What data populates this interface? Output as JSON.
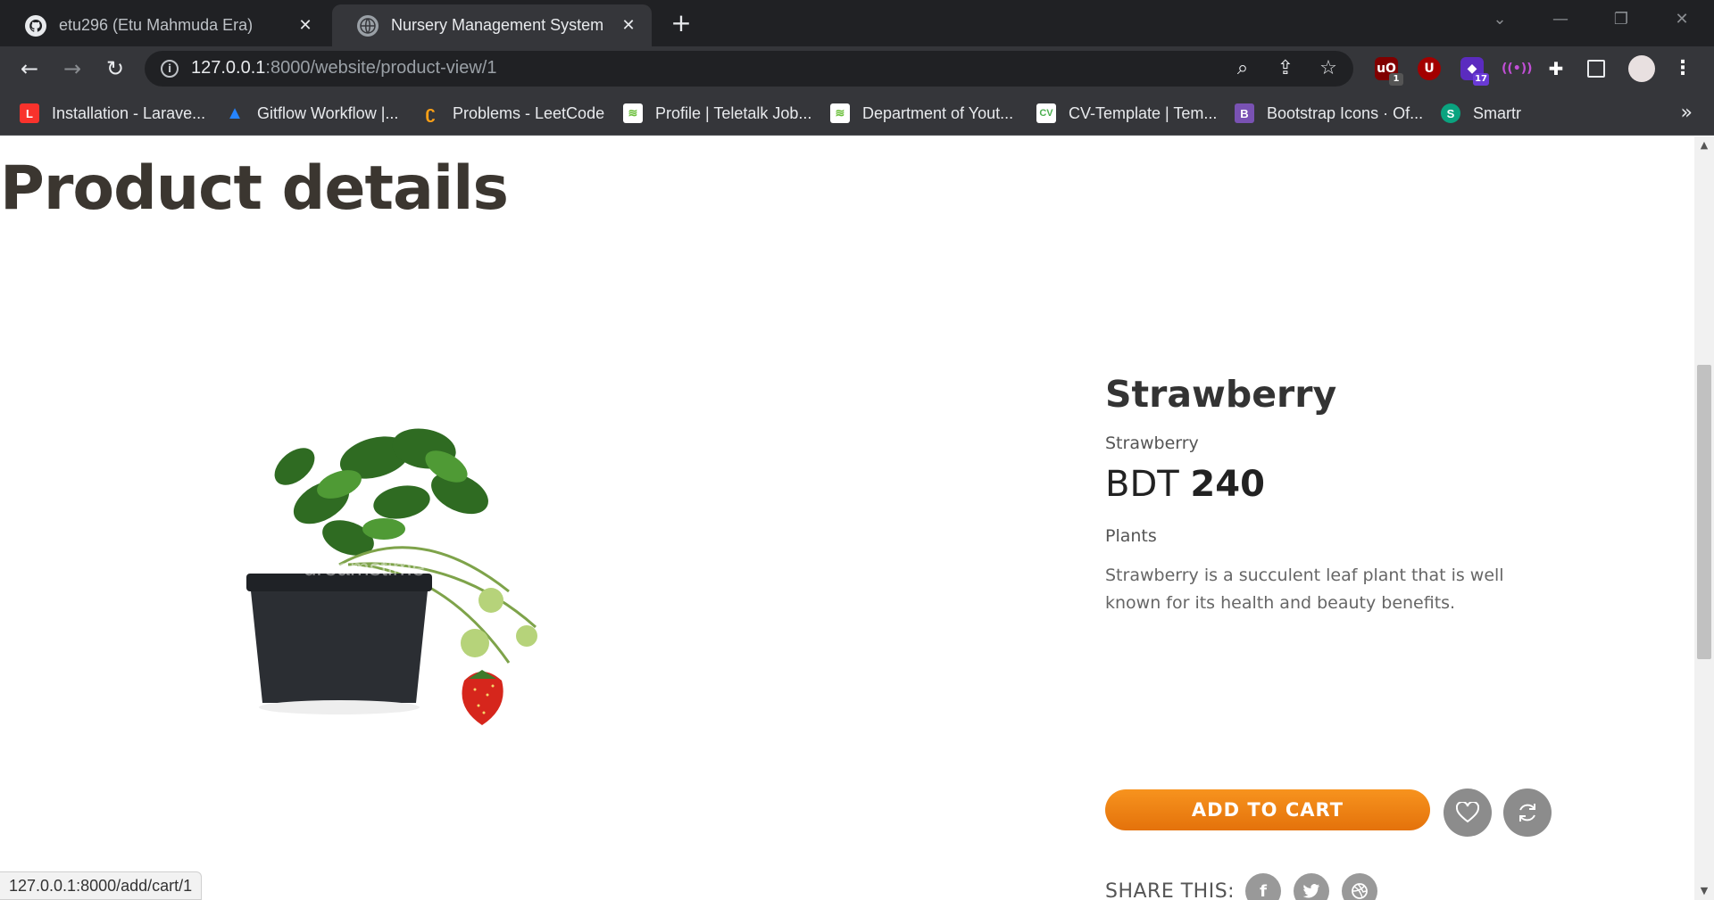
{
  "browser": {
    "tabs": [
      {
        "title": "etu296 (Etu Mahmuda Era)",
        "icon": "github-icon",
        "active": false
      },
      {
        "title": "Nursery Management System",
        "icon": "globe-icon",
        "active": true
      }
    ],
    "new_tab_label": "+",
    "url_host": "127.0.0.1",
    "url_path": ":8000/website/product-view/1",
    "extension_badges": {
      "ublock": "1",
      "extension_count": "17"
    },
    "bookmarks": [
      {
        "label": "Installation - Larave...",
        "icon": "laravel-icon",
        "color": "#f9322c"
      },
      {
        "label": "Gitflow Workflow |...",
        "icon": "atlassian-icon",
        "color": "#2684ff"
      },
      {
        "label": "Problems - LeetCode",
        "icon": "leetcode-icon",
        "color": "#ffa116"
      },
      {
        "label": "Profile | Teletalk Job...",
        "icon": "teletalk-icon",
        "color": "#6bbf3b"
      },
      {
        "label": "Department of Yout...",
        "icon": "teletalk-icon",
        "color": "#6bbf3b"
      },
      {
        "label": "CV-Template | Tem...",
        "icon": "cv-icon",
        "color": "#4caf50"
      },
      {
        "label": "Bootstrap Icons · Of...",
        "icon": "bootstrap-icon",
        "color": "#7952b3"
      },
      {
        "label": "Smartr",
        "icon": "smartr-icon",
        "color": "#0aa37f"
      }
    ],
    "bookmarks_more": "»"
  },
  "page": {
    "title": "Product details",
    "product": {
      "name": "Strawberry",
      "subtitle": "Strawberry",
      "currency": "BDT",
      "price": "240",
      "category": "Plants",
      "description": "Strawberry is a succulent leaf plant that is well known for its health and beauty benefits.",
      "add_to_cart_label": "ADD TO CART",
      "share_label": "SHARE THIS:",
      "image_watermark": "dreamstime"
    }
  },
  "status_bar": {
    "url": "127.0.0.1:8000/add/cart/1"
  },
  "colors": {
    "accent_orange": "#f7931e",
    "heading": "#3b3630",
    "chrome_dark": "#202124",
    "chrome_toolbar": "#35363a"
  }
}
